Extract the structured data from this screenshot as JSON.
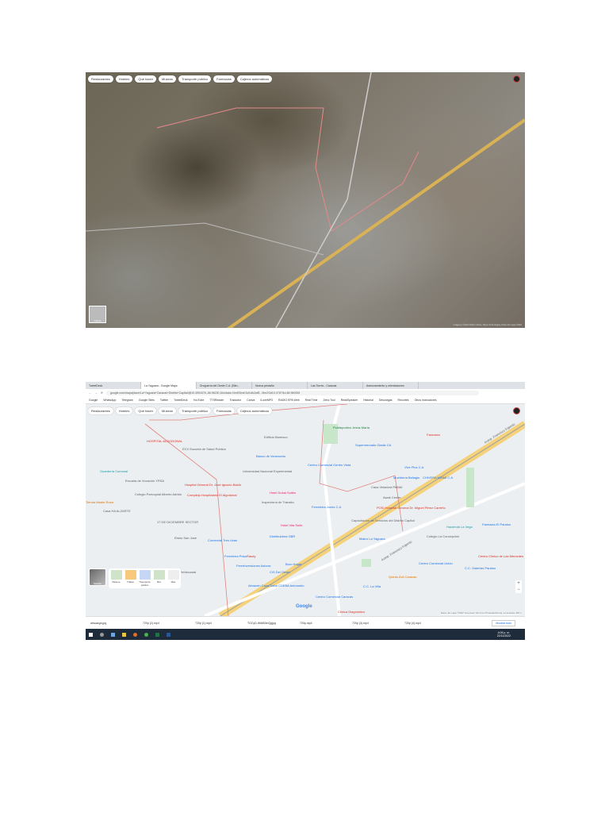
{
  "satellite": {
    "chips": [
      "Restaurantes",
      "Hoteles",
      "Qué hacer",
      "Museos",
      "Transporte público",
      "Farmacias",
      "Cajeros automáticos"
    ],
    "footer": "Imágenes ©2022 CNES / Airbus, Maxar Technologies, Datos del mapa ©2022",
    "layers_label": "Capas"
  },
  "browser": {
    "tabs": [
      "TweetDeck",
      "La Yaguara - Google Maps",
      "Droguería del Oeste C.A. (Blm...",
      "Nueva pestaña",
      "Las Torres - Caracas",
      "Asesoramiento y orientaciones"
    ],
    "url": "google.com/maps/place/La+Yaguara+Caracas+Distrito+Capital/@10.4904476,-66.96230,16z/data=!4m5!3m4!1s0x8c2af5...!8m2!3d10.4767!4d-66.960006",
    "bookmarks": [
      "Google",
      "WhatsApp",
      "Telegram",
      "Google Sites",
      "Twitter",
      "TweetDeck",
      "YouTube",
      "TTSReader",
      "Traductor",
      "Canva",
      "iLoveMP3",
      "RADIO EPA Web",
      "Real Time",
      "Zeno Tool",
      "ReadSpeaker",
      "Historial",
      "Descargas",
      "Recortes",
      "Otros marcadores"
    ],
    "chips": [
      "Restaurantes",
      "Hoteles",
      "Qué hacer",
      "Museos",
      "Transporte público",
      "Farmacias",
      "Cajeros automáticos"
    ],
    "map_labels": [
      "HOSPITAL ALGODONAL",
      "ECV Escuela de Salud Pública",
      "Hospital General Dr. José Ignacio Baldó",
      "Complejo Hospitalario El Algodonal",
      "Universidad Nacional Experimental",
      "Banco de Venezuela",
      "Hotel Dubai Suites",
      "Inspectoría de Tránsito",
      "Edificio Banesco",
      "Hotel Vita Suite",
      "Distribuidora GBR",
      "Polideportivo Jesús María",
      "Farmacia",
      "Supermercado Gladiz CA",
      "Centro Comercial Centro Vista",
      "Vive Plus C.A",
      "CHIVERA MIAMI C.A",
      "Mueblería Bellagio",
      "Casa Veladora PAMAI",
      "Awak Center",
      "POSI Hospital General Dr. Miguel Pérez Carreño",
      "Ferretería Jones C.A",
      "Hacienda La Vega",
      "Colegio La Concepción",
      "Centro Clínico de Las Mercedes",
      "Centro Comercial Unión",
      "C.C. Galerías Paraíso",
      "Quinta Ávil Caracas",
      "C.C. La Villa",
      "Centro Comercial Caracas",
      "Clínica Diagnóstico",
      "Makro La Yaguara",
      "Capacitación de Servicios del Distrito Capital",
      "Comercial Tres Uvas",
      "Ferretería Prisa",
      "Rasdy",
      "Ferreinversiones Aslorra",
      "Almacén Cava Gaba CDEBA Antonuelo",
      "Boro Hogar",
      "C/S Del Oeste",
      "Iglesia Evangélica Pentecostal",
      "Escuela de Vocación YRSA",
      "Colegio Parroquial Alberto Adrián",
      "Casa HA ALZARTE",
      "17 DE DICIEMBRE SECTOR",
      "Ebelo San José",
      "Guardería Comunal",
      "Tienda Madre Rosa",
      "Autop. Francisco Fajardo",
      "Autop. Francisco Fajardo",
      "Farmacia El Paraíso"
    ],
    "layers": [
      "Relieve",
      "Tráfico",
      "Transporte público",
      "Bici",
      "Más"
    ],
    "layers_thumb": "Satélite",
    "google_logo": "Google",
    "map_footer": "Datos del mapa ©2022  Venezuela  Términos  Privacidad  Enviar comentarios  200 m",
    "downloads": [
      "descarga.jpg",
      "720p (2).mp4",
      "720p (1).mp4",
      "TGCyD-WlAB0mQgjpg",
      "720p.mp4",
      "720p (3).mp4",
      "720p (4).mp4"
    ],
    "show_all": "Mostrar todo",
    "clock_time": "4:05 p. m.",
    "clock_date": "22/11/2022"
  }
}
